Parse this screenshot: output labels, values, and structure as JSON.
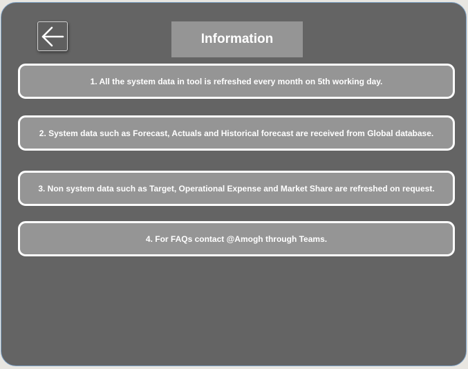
{
  "header": {
    "back_icon": "arrow-left-icon",
    "title": "Information"
  },
  "info_items": [
    {
      "text": "1. All the system data in tool is refreshed every month on 5th working day."
    },
    {
      "text": "2. System data such as Forecast, Actuals and Historical forecast are received from Global database."
    },
    {
      "text": "3. Non system data such as Target, Operational Expense and Market Share are refreshed on request."
    },
    {
      "text": "4. For FAQs contact @Amogh through Teams."
    }
  ],
  "colors": {
    "panel_background": "#646464",
    "box_fill": "#959595",
    "box_border": "#ffffff",
    "text": "#ffffff"
  }
}
